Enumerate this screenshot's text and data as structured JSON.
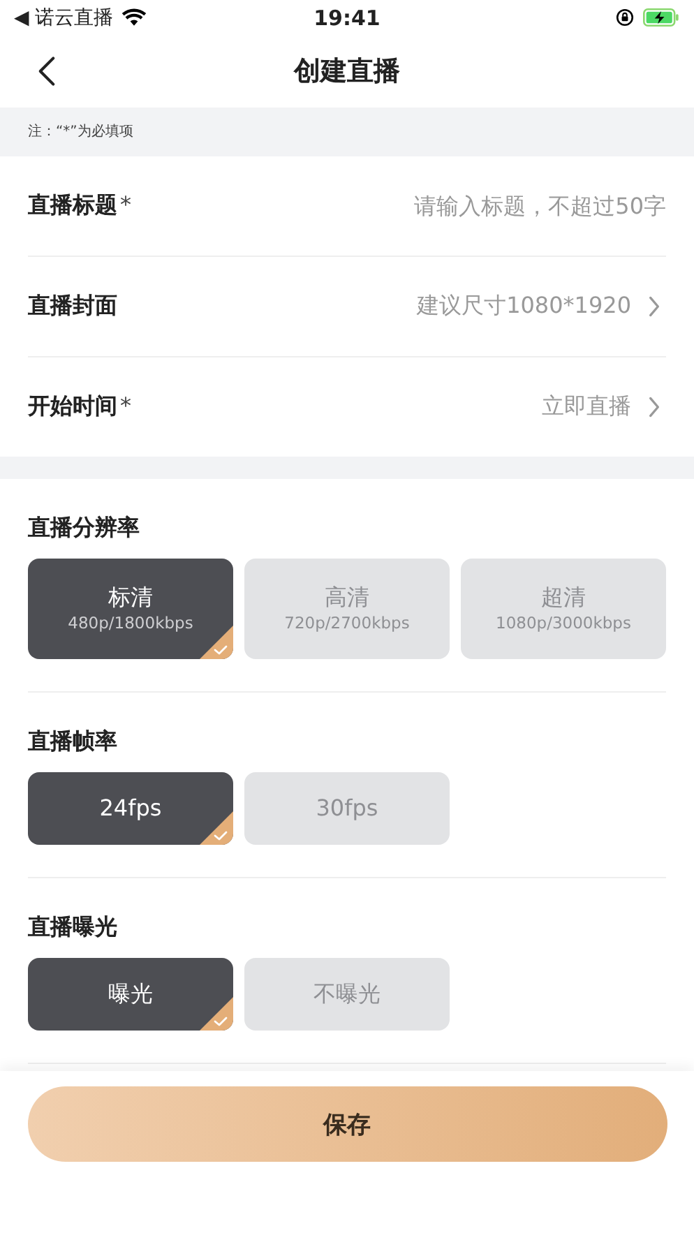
{
  "status_bar": {
    "back_app": "◀ 诺云直播",
    "time": "19:41"
  },
  "nav": {
    "title": "创建直播"
  },
  "note": "注：“*”为必填项",
  "fields": [
    {
      "kind": "input",
      "label": "直播标题",
      "required_mark": "*",
      "placeholder": "请输入标题，不超过50字"
    },
    {
      "kind": "select",
      "label": "直播封面",
      "value": "建议尺寸1080*1920"
    },
    {
      "kind": "select",
      "label": "开始时间",
      "required_mark": "*",
      "value": "立即直播"
    }
  ],
  "sections": [
    {
      "title": "直播分辨率",
      "options": [
        {
          "label": "标清",
          "detail": "480p/1800kbps",
          "selected": true
        },
        {
          "label": "高清",
          "detail": "720p/2700kbps",
          "selected": false
        },
        {
          "label": "超清",
          "detail": "1080p/3000kbps",
          "selected": false
        }
      ]
    },
    {
      "title": "直播帧率",
      "options": [
        {
          "label": "24fps",
          "selected": true
        },
        {
          "label": "30fps",
          "selected": false
        }
      ]
    },
    {
      "title": "直播曝光",
      "options": [
        {
          "label": "曝光",
          "selected": true
        },
        {
          "label": "不曝光",
          "selected": false
        }
      ]
    }
  ],
  "save_button": "保存"
}
